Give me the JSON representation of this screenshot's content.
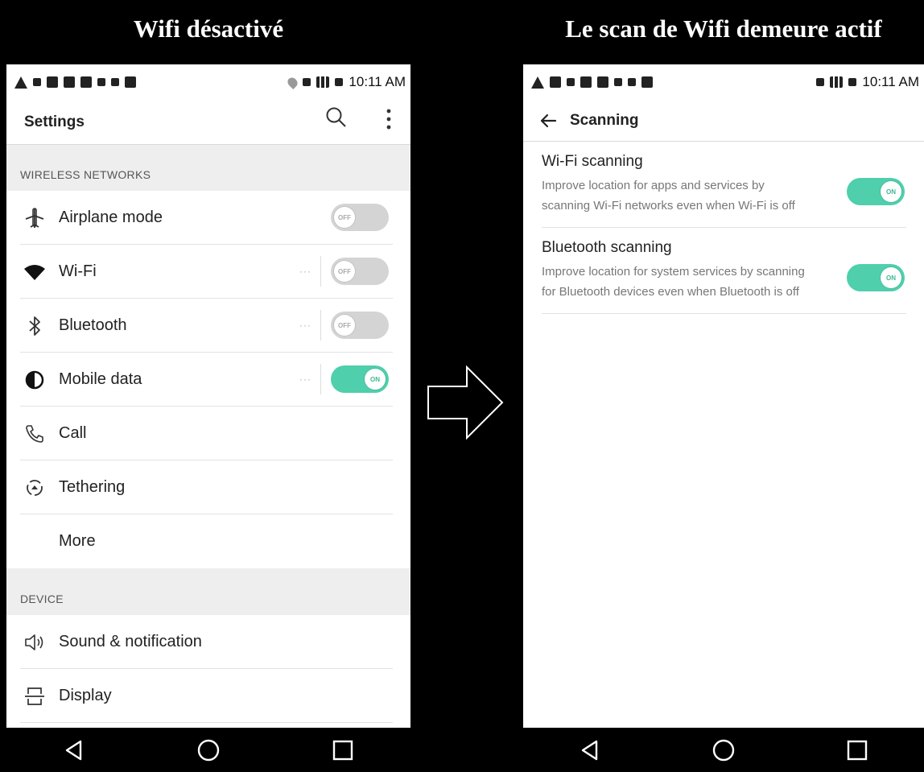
{
  "left": {
    "caption": "Wifi désactivé",
    "status_time": "10:11 AM",
    "app_title": "Settings",
    "sections": [
      {
        "header": "WIRELESS NETWORKS"
      },
      {
        "header": "DEVICE"
      }
    ],
    "wireless_items": [
      {
        "label": "Airplane mode",
        "icon": "airplane-icon",
        "toggle": "off",
        "toggle_text": "OFF",
        "has_more": false
      },
      {
        "label": "Wi-Fi",
        "icon": "wifi-icon",
        "toggle": "off",
        "toggle_text": "OFF",
        "has_more": true,
        "more_text": "···"
      },
      {
        "label": "Bluetooth",
        "icon": "bluetooth-icon",
        "toggle": "off",
        "toggle_text": "OFF",
        "has_more": true,
        "more_text": "···"
      },
      {
        "label": "Mobile data",
        "icon": "mobile-data-icon",
        "toggle": "on",
        "toggle_text": "ON",
        "has_more": true,
        "more_text": "···"
      },
      {
        "label": "Call",
        "icon": "call-icon"
      },
      {
        "label": "Tethering",
        "icon": "tethering-icon"
      },
      {
        "label": "More",
        "icon": ""
      }
    ],
    "device_items": [
      {
        "label": "Sound & notification",
        "icon": "sound-icon"
      },
      {
        "label": "Display",
        "icon": "display-icon"
      }
    ]
  },
  "right": {
    "caption": "Le scan de Wifi demeure actif",
    "status_time": "10:11 AM",
    "app_title": "Scanning",
    "items": [
      {
        "title": "Wi-Fi scanning",
        "summary": "Improve location for apps and services by scanning Wi-Fi networks even when Wi-Fi is off",
        "toggle": "on",
        "toggle_text": "ON"
      },
      {
        "title": "Bluetooth scanning",
        "summary": "Improve location for system services by scanning for Bluetooth devices even when Bluetooth is off",
        "toggle": "on",
        "toggle_text": "ON"
      }
    ]
  },
  "colors": {
    "toggle_on": "#4fcfac",
    "toggle_off": "#d4d4d4",
    "section_bg": "#eeeeee"
  }
}
